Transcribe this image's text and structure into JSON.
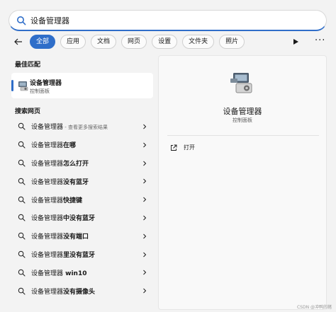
{
  "search": {
    "query": "设备管理器"
  },
  "filters": {
    "tabs": [
      {
        "label": "全部",
        "active": true
      },
      {
        "label": "应用"
      },
      {
        "label": "文档"
      },
      {
        "label": "网页"
      },
      {
        "label": "设置"
      },
      {
        "label": "文件夹"
      },
      {
        "label": "照片"
      }
    ],
    "more_label": "···"
  },
  "best_match": {
    "section_title": "最佳匹配",
    "name": "设备管理器",
    "subtitle": "控制面板",
    "icon": "device-manager-icon"
  },
  "web_search": {
    "section_title": "搜索网页",
    "items": [
      {
        "base": "设备管理器",
        "bold": "",
        "hint": " - 查看更多搜索结果"
      },
      {
        "base": "设备管理器",
        "bold": "在哪",
        "hint": ""
      },
      {
        "base": "设备管理器",
        "bold": "怎么打开",
        "hint": ""
      },
      {
        "base": "设备管理器",
        "bold": "没有蓝牙",
        "hint": ""
      },
      {
        "base": "设备管理器",
        "bold": "快捷键",
        "hint": ""
      },
      {
        "base": "设备管理器",
        "bold": "中没有蓝牙",
        "hint": ""
      },
      {
        "base": "设备管理器",
        "bold": "没有端口",
        "hint": ""
      },
      {
        "base": "设备管理器",
        "bold": "里没有蓝牙",
        "hint": ""
      },
      {
        "base": "设备管理器",
        "bold": " win10",
        "hint": ""
      },
      {
        "base": "设备管理器",
        "bold": "没有摄像头",
        "hint": ""
      }
    ]
  },
  "detail": {
    "title": "设备管理器",
    "type": "控制面板",
    "actions": [
      {
        "label": "打开",
        "icon": "open-external-icon"
      }
    ]
  },
  "watermark": "CSDN @冲鸭的猪",
  "colors": {
    "accent": "#2f6ec9",
    "background": "#f3f3f3",
    "card": "#ffffff"
  }
}
